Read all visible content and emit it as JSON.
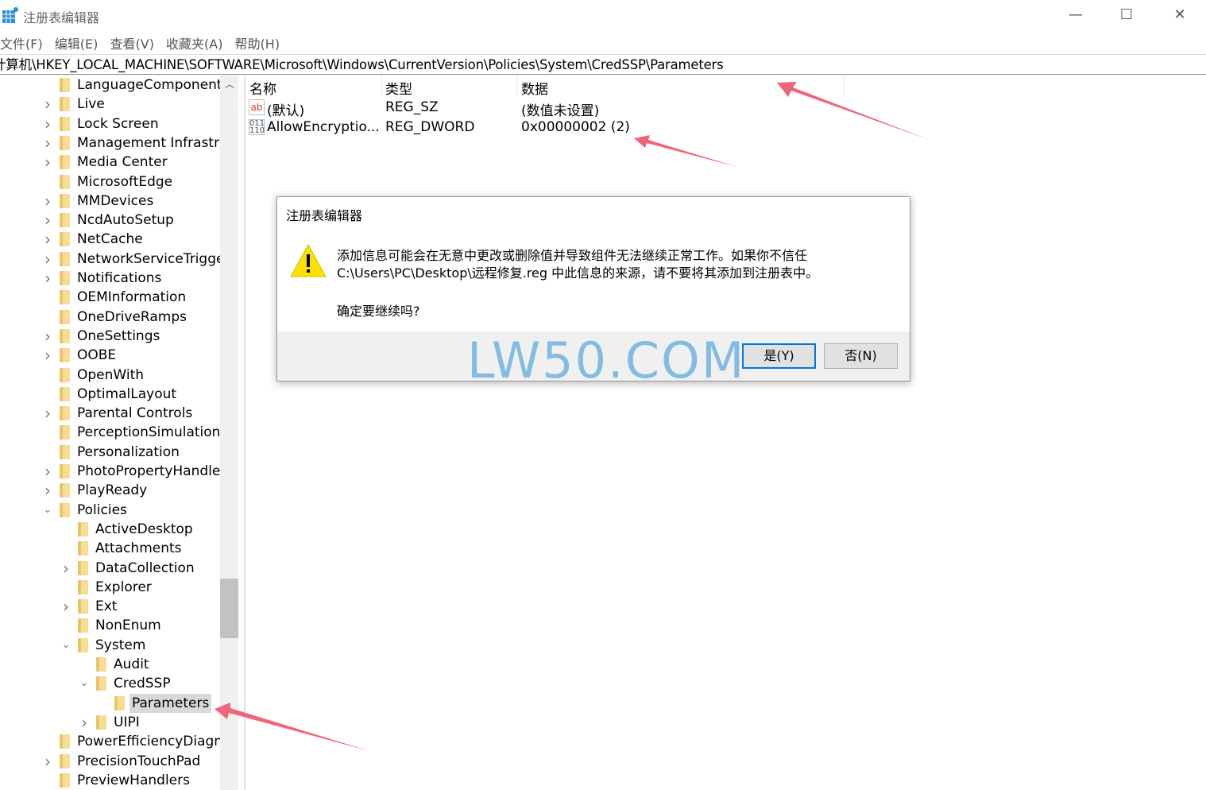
{
  "window": {
    "title": "注册表编辑器",
    "minimize": "—",
    "maximize": "☐",
    "close": "✕"
  },
  "menu": [
    "文件(F)",
    "编辑(E)",
    "查看(V)",
    "收藏夹(A)",
    "帮助(H)"
  ],
  "address": "计算机\\HKEY_LOCAL_MACHINE\\SOFTWARE\\Microsoft\\Windows\\CurrentVersion\\Policies\\System\\CredSSP\\Parameters",
  "tree": [
    {
      "label": "LanguageComponents",
      "level": 1,
      "expander": "none"
    },
    {
      "label": "Live",
      "level": 1,
      "expander": "collapsed"
    },
    {
      "label": "Lock Screen",
      "level": 1,
      "expander": "collapsed"
    },
    {
      "label": "Management Infrastructure",
      "level": 1,
      "expander": "collapsed"
    },
    {
      "label": "Media Center",
      "level": 1,
      "expander": "collapsed"
    },
    {
      "label": "MicrosoftEdge",
      "level": 1,
      "expander": "none"
    },
    {
      "label": "MMDevices",
      "level": 1,
      "expander": "collapsed"
    },
    {
      "label": "NcdAutoSetup",
      "level": 1,
      "expander": "collapsed"
    },
    {
      "label": "NetCache",
      "level": 1,
      "expander": "collapsed"
    },
    {
      "label": "NetworkServiceTriggers",
      "level": 1,
      "expander": "collapsed"
    },
    {
      "label": "Notifications",
      "level": 1,
      "expander": "collapsed"
    },
    {
      "label": "OEMInformation",
      "level": 1,
      "expander": "none"
    },
    {
      "label": "OneDriveRamps",
      "level": 1,
      "expander": "none"
    },
    {
      "label": "OneSettings",
      "level": 1,
      "expander": "collapsed"
    },
    {
      "label": "OOBE",
      "level": 1,
      "expander": "collapsed"
    },
    {
      "label": "OpenWith",
      "level": 1,
      "expander": "none"
    },
    {
      "label": "OptimalLayout",
      "level": 1,
      "expander": "none"
    },
    {
      "label": "Parental Controls",
      "level": 1,
      "expander": "collapsed"
    },
    {
      "label": "PerceptionSimulationExtensions",
      "level": 1,
      "expander": "none"
    },
    {
      "label": "Personalization",
      "level": 1,
      "expander": "none"
    },
    {
      "label": "PhotoPropertyHandler",
      "level": 1,
      "expander": "collapsed"
    },
    {
      "label": "PlayReady",
      "level": 1,
      "expander": "collapsed"
    },
    {
      "label": "Policies",
      "level": 1,
      "expander": "expanded"
    },
    {
      "label": "ActiveDesktop",
      "level": 2,
      "expander": "none"
    },
    {
      "label": "Attachments",
      "level": 2,
      "expander": "none"
    },
    {
      "label": "DataCollection",
      "level": 2,
      "expander": "collapsed"
    },
    {
      "label": "Explorer",
      "level": 2,
      "expander": "none"
    },
    {
      "label": "Ext",
      "level": 2,
      "expander": "collapsed"
    },
    {
      "label": "NonEnum",
      "level": 2,
      "expander": "none"
    },
    {
      "label": "System",
      "level": 2,
      "expander": "expanded"
    },
    {
      "label": "Audit",
      "level": 3,
      "expander": "none"
    },
    {
      "label": "CredSSP",
      "level": 3,
      "expander": "expanded"
    },
    {
      "label": "Parameters",
      "level": 4,
      "expander": "none",
      "selected": true
    },
    {
      "label": "UIPI",
      "level": 3,
      "expander": "collapsed"
    },
    {
      "label": "PowerEfficiencyDiagnostics",
      "level": 1,
      "expander": "none"
    },
    {
      "label": "PrecisionTouchPad",
      "level": 1,
      "expander": "collapsed"
    },
    {
      "label": "PreviewHandlers",
      "level": 1,
      "expander": "none"
    }
  ],
  "columns": {
    "name": "名称",
    "type": "类型",
    "data": "数据"
  },
  "values": [
    {
      "icon": "string-value-icon",
      "glyph": "ab",
      "name": "(默认)",
      "type": "REG_SZ",
      "data": "(数值未设置)"
    },
    {
      "icon": "binary-value-icon",
      "glyph": "011 110",
      "name": "AllowEncryptio...",
      "type": "REG_DWORD",
      "data": "0x00000002 (2)"
    }
  ],
  "dialog": {
    "title": "注册表编辑器",
    "message_line1": "添加信息可能会在无意中更改或删除值并导致组件无法继续正常工作。如果你不信任",
    "message_line2": "C:\\Users\\PC\\Desktop\\远程修复.reg 中此信息的来源，请不要将其添加到注册表中。",
    "question": "确定要继续吗?",
    "yes": "是(Y)",
    "no": "否(N)"
  },
  "watermark": "LW50.COM",
  "colors": {
    "accent": "#0078d7",
    "annotation_arrow": "#f0657a",
    "folder": "#f7dd93"
  }
}
